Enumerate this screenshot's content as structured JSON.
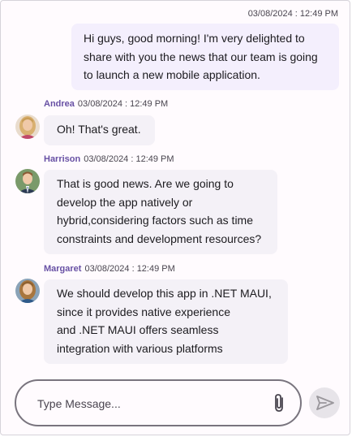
{
  "outgoing": {
    "timestamp": "03/08/2024 : 12:49 PM",
    "lines": [
      "Hi guys, good morning! I'm very delighted to",
      "share with you the news that our team is going",
      "to launch a new mobile application."
    ]
  },
  "messages": [
    {
      "author": "Andrea",
      "timestamp": "03/08/2024 : 12:49 PM",
      "avatar": "woman-blonde-avatar",
      "lines": [
        "Oh! That's great."
      ]
    },
    {
      "author": "Harrison",
      "timestamp": "03/08/2024 : 12:49 PM",
      "avatar": "man-suit-avatar",
      "lines": [
        "That is good news. Are we going to",
        "develop the app natively or",
        "hybrid,considering factors such as time",
        "constraints and development resources?"
      ]
    },
    {
      "author": "Margaret",
      "timestamp": "03/08/2024 : 12:49 PM",
      "avatar": "woman-brunette-avatar",
      "lines": [
        "We should develop this app in .NET MAUI,",
        "since it provides native experience",
        "and .NET MAUI offers seamless",
        "integration with various platforms"
      ]
    }
  ],
  "composer": {
    "placeholder": "Type Message...",
    "attach_icon": "paperclip-icon",
    "send_icon": "send-icon"
  },
  "colors": {
    "outgoing_bubble": "#f4effd",
    "incoming_bubble": "#f4f1f7",
    "author_name": "#6750a4",
    "send_button": "#e7e4e9"
  }
}
